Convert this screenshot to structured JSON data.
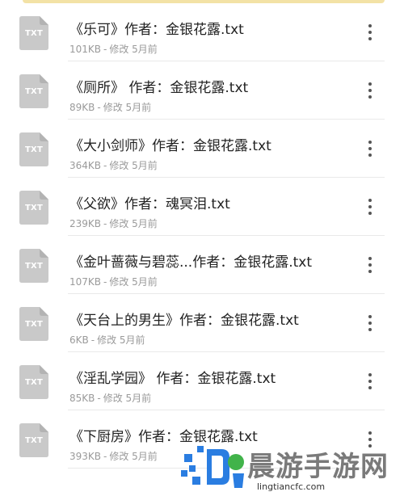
{
  "files": [
    {
      "name": "《乐可》作者：金银花露.txt",
      "size": "101KB",
      "modified": "修改 5月前",
      "icon": "txt-file-icon",
      "ext": "TXT"
    },
    {
      "name": "《厕所》 作者：金银花露.txt",
      "size": "89KB",
      "modified": "修改 5月前",
      "icon": "txt-file-icon",
      "ext": "TXT"
    },
    {
      "name": "《大小剑师》作者：金银花露.txt",
      "size": "364KB",
      "modified": "修改 5月前",
      "icon": "txt-file-icon",
      "ext": "TXT"
    },
    {
      "name": "《父欲》作者：魂冥泪.txt",
      "size": "239KB",
      "modified": "修改 5月前",
      "icon": "txt-file-icon",
      "ext": "TXT"
    },
    {
      "name": "《金叶蔷薇与碧蕊...作者：金银花露.txt",
      "size": "107KB",
      "modified": "修改 5月前",
      "icon": "txt-file-icon",
      "ext": "TXT"
    },
    {
      "name": "《天台上的男生》作者：金银花露.txt",
      "size": "6KB",
      "modified": "修改 5月前",
      "icon": "txt-file-icon",
      "ext": "TXT"
    },
    {
      "name": "《淫乱学园》 作者：金银花露.txt",
      "size": "85KB",
      "modified": "修改 5月前",
      "icon": "txt-file-icon",
      "ext": "TXT"
    },
    {
      "name": "《下厨房》作者：金银花露.txt",
      "size": "393KB",
      "modified": "修改 5月前",
      "icon": "txt-file-icon",
      "ext": "TXT"
    }
  ],
  "meta_separator": "-",
  "more_icon": "more-vertical-icon",
  "watermark": {
    "text": "晨游手游网",
    "url": "lingtiancfc.com"
  },
  "colors": {
    "icon_gray": "#c9c9c9",
    "text": "#222222",
    "meta": "#9a9a9a",
    "divider": "#e9e9e9"
  }
}
